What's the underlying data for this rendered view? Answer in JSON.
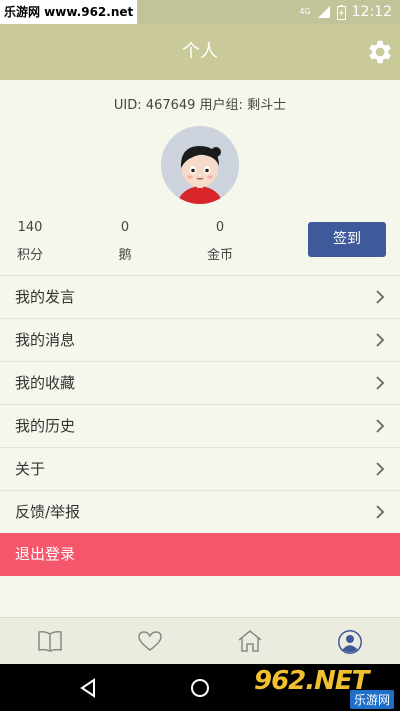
{
  "status_bar": {
    "watermark": "乐游网 www.962.net",
    "network": "4G",
    "time": "12:12"
  },
  "header": {
    "title": "个人",
    "settings_icon": "gear-icon"
  },
  "profile": {
    "uid_line": "UID: 467649 用户组: 剩斗士",
    "avatar": "cartoon-girl-avatar"
  },
  "stats": [
    {
      "value": "140",
      "label": "积分"
    },
    {
      "value": "0",
      "label": "鹅"
    },
    {
      "value": "0",
      "label": "金币"
    }
  ],
  "checkin_label": "签到",
  "menu": [
    {
      "label": "我的发言"
    },
    {
      "label": "我的消息"
    },
    {
      "label": "我的收藏"
    },
    {
      "label": "我的历史"
    },
    {
      "label": "关于"
    },
    {
      "label": "反馈/举报"
    }
  ],
  "logout_label": "退出登录",
  "tabs": [
    {
      "icon": "book-icon",
      "active": false
    },
    {
      "icon": "heart-icon",
      "active": false
    },
    {
      "icon": "home-icon",
      "active": false
    },
    {
      "icon": "user-icon",
      "active": true
    }
  ],
  "watermark_bottom": {
    "big": "962.NET",
    "small": "乐游网"
  },
  "colors": {
    "header": "#c9c99a",
    "background": "#f6f7ec",
    "checkin_button": "#3f5a9a",
    "logout": "#f5566b",
    "active_tab": "#3f5a9a"
  }
}
